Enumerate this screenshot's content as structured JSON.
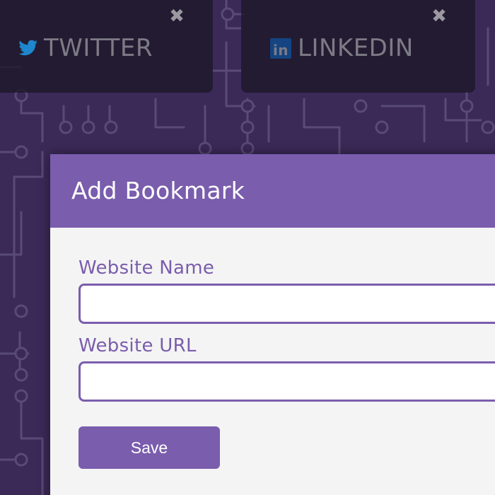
{
  "colors": {
    "background": "#3b2a58",
    "circuit_lines": "#5a4a78",
    "accent": "#7a5dad",
    "card_background": "#1e182a",
    "card_text": "#7d7b86",
    "twitter_blue": "#1da1f2",
    "linkedin_blue": "#0a66c2",
    "modal_body": "#f4f4f4"
  },
  "bookmarks": [
    {
      "name": "TWITTER",
      "icon": "twitter-bird-icon",
      "close_icon": "close-icon",
      "close_glyph": "✖"
    },
    {
      "name": "LINKEDIN",
      "icon": "linkedin-logo-icon",
      "close_icon": "close-icon",
      "close_glyph": "✖"
    }
  ],
  "linkedin_logo_text": "in",
  "modal": {
    "title": "Add Bookmark",
    "fields": [
      {
        "label": "Website Name",
        "value": "",
        "placeholder": ""
      },
      {
        "label": "Website URL",
        "value": "",
        "placeholder": ""
      }
    ],
    "save_label": "Save"
  }
}
